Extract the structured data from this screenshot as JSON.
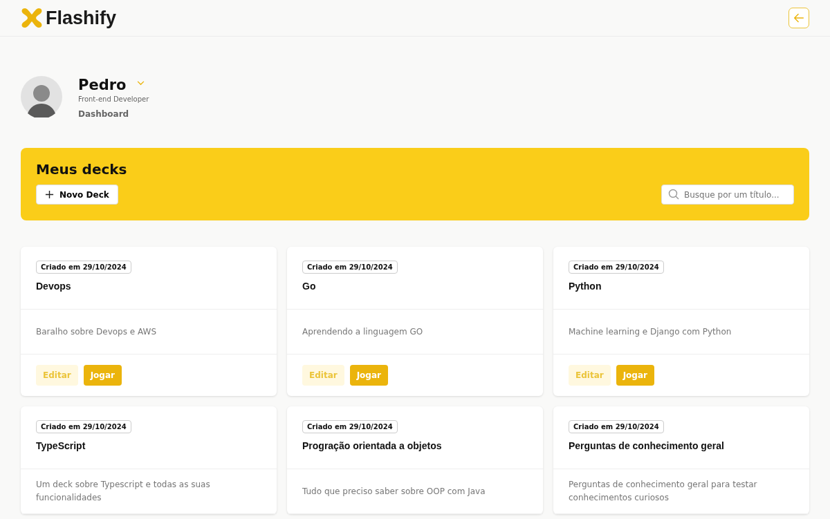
{
  "header": {
    "logo": "Flashify"
  },
  "profile": {
    "name": "Pedro",
    "role": "Front-end Developer",
    "link": "Dashboard"
  },
  "banner": {
    "title": "Meus decks",
    "new_button": "Novo Deck",
    "search": {
      "placeholder": "Busque por um título..."
    }
  },
  "decks": [
    {
      "date": "Criado em 29/10/2024",
      "title": "Devops",
      "description": "Baralho sobre Devops e AWS",
      "buttons": [
        "Editar",
        "Jogar"
      ]
    },
    {
      "date": "Criado em 29/10/2024",
      "title": "Go",
      "description": "Aprendendo a linguagem GO",
      "buttons": [
        "Editar",
        "Jogar"
      ]
    },
    {
      "date": "Criado em 29/10/2024",
      "title": "Python",
      "description": "Machine learning e Django com Python",
      "buttons": [
        "Editar",
        "Jogar"
      ]
    },
    {
      "date": "Criado em 29/10/2024",
      "title": "TypeScript",
      "description": "Um deck sobre Typescript e todas as suas funcionalidades"
    },
    {
      "date": "Criado em 29/10/2024",
      "title": "Progração orientada a objetos",
      "description": "Tudo que preciso saber sobre OOP com Java"
    },
    {
      "date": "Criado em 29/10/2024",
      "title": "Perguntas de conhecimento geral",
      "description": "Perguntas de conhecimento geral para testar conhecimentos curiosos"
    }
  ]
}
